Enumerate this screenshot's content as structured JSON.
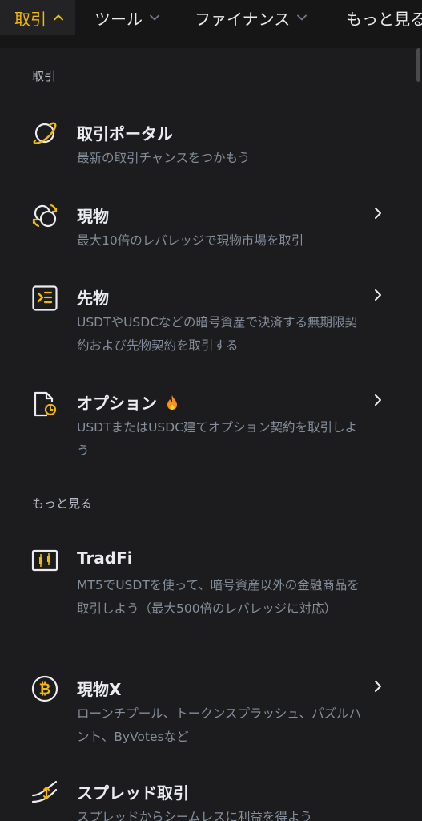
{
  "topnav": {
    "items": [
      {
        "label": "取引"
      },
      {
        "label": "ツール"
      },
      {
        "label": "ファイナンス"
      },
      {
        "label": "もっと見る"
      }
    ]
  },
  "sections": {
    "trade": {
      "title": "取引",
      "items": [
        {
          "title": "取引ポータル",
          "desc": "最新の取引チャンスをつかもう",
          "icon": "planet-icon"
        },
        {
          "title": "現物",
          "desc": "最大10倍のレバレッジで現物市場を取引",
          "icon": "spot-exchange-icon"
        },
        {
          "title": "先物",
          "desc": "USDTやUSDCなどの暗号資産で決済する無期限契約および先物契約を取引する",
          "icon": "futures-icon"
        },
        {
          "title": "オプション",
          "desc": "USDTまたはUSDC建てオプション契約を取引しよう",
          "icon": "options-icon"
        }
      ]
    },
    "more": {
      "title": "もっと見る",
      "items": [
        {
          "title": "TradFi",
          "desc": "MT5でUSDTを使って、暗号資産以外の金融商品を取引しよう（最大500倍のレバレッジに対応）",
          "icon": "candlestick-icon"
        },
        {
          "title": "現物X",
          "desc": "ローンチプール、トークンスプラッシュ、パズルハント、ByVotesなど",
          "icon": "bitcoin-icon"
        },
        {
          "title": "スプレッド取引",
          "desc": "スプレッドからシームレスに利益を得よう",
          "icon": "spread-icon"
        }
      ]
    }
  },
  "colors": {
    "accent": "#f0b90b",
    "background": "#1c1c1e",
    "text_primary": "#eaecef",
    "text_secondary": "#848e9c",
    "fire": "#f7931a"
  }
}
